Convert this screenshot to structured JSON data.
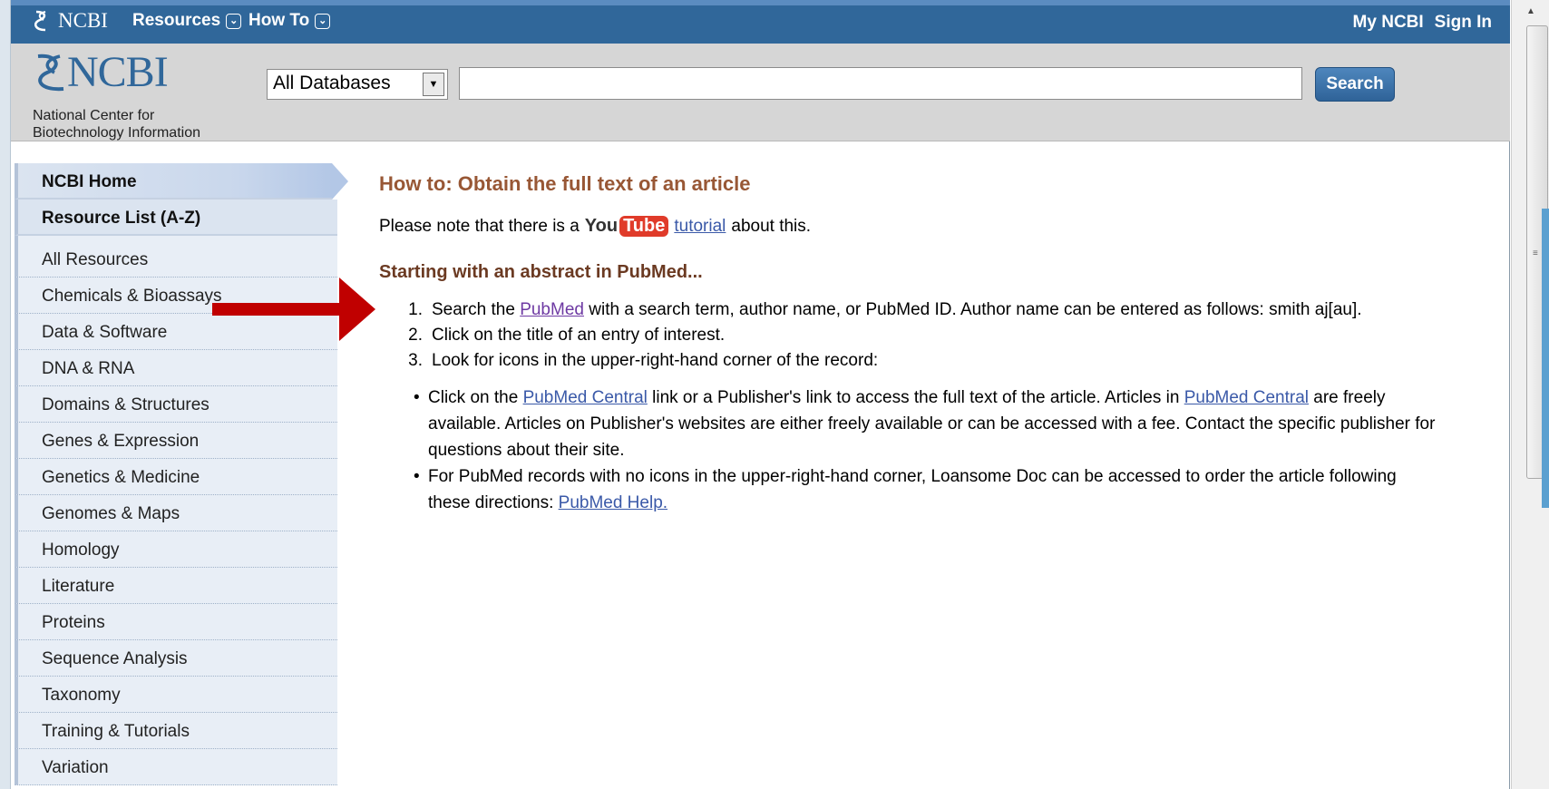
{
  "topbar": {
    "logo_text": "NCBI",
    "resources_label": "Resources",
    "howto_label": "How To",
    "my_ncbi": "My NCBI",
    "sign_in": "Sign In"
  },
  "header": {
    "logo_word": "NCBI",
    "logo_sub_line1": "National Center for",
    "logo_sub_line2": "Biotechnology Information",
    "db_selected": "All Databases",
    "search_value": "",
    "search_button": "Search"
  },
  "sidebar": {
    "home": "NCBI Home",
    "resource_list": "Resource List (A-Z)",
    "items": [
      "All Resources",
      "Chemicals & Bioassays",
      "Data & Software",
      "DNA & RNA",
      "Domains & Structures",
      "Genes & Expression",
      "Genetics & Medicine",
      "Genomes & Maps",
      "Homology",
      "Literature",
      "Proteins",
      "Sequence Analysis",
      "Taxonomy",
      "Training & Tutorials",
      "Variation"
    ]
  },
  "content": {
    "title": "How to: Obtain the full text of an article",
    "note_prefix": "Please note that there is a",
    "youtube_you": "You",
    "youtube_tube": "Tube",
    "note_link": "tutorial",
    "note_suffix": "about this.",
    "subhead": "Starting with an abstract in PubMed...",
    "step1_pre": "Search the",
    "step1_link": "PubMed",
    "step1_post": "with a search term, author name, or PubMed ID. Author name can be entered as follows: smith aj[au].",
    "step2": "Click on the title of an entry of interest.",
    "step3": "Look for icons in the upper-right-hand corner of the record:",
    "bullet1_pre": "Click on the",
    "bullet1_link1": "PubMed Central",
    "bullet1_mid": "link or a Publisher's link to access the full text of the article.  Articles in",
    "bullet1_link2": "PubMed Central",
    "bullet1_post": "are freely available.  Articles on Publisher's websites are either freely available or can be accessed with a fee.  Contact the specific publisher for questions about their site.",
    "bullet2_pre": "For PubMed records with no icons in the upper-right-hand corner, Loansome Doc can be accessed to order the article following these directions:",
    "bullet2_link": "PubMed Help."
  },
  "annotation": {
    "arrow_color": "#c00000",
    "arrow_target": "Chemicals & Bioassays"
  },
  "colors": {
    "topbar": "#30679a",
    "header": "#d6d6d6",
    "title": "#985735",
    "link": "#3a59a8"
  }
}
